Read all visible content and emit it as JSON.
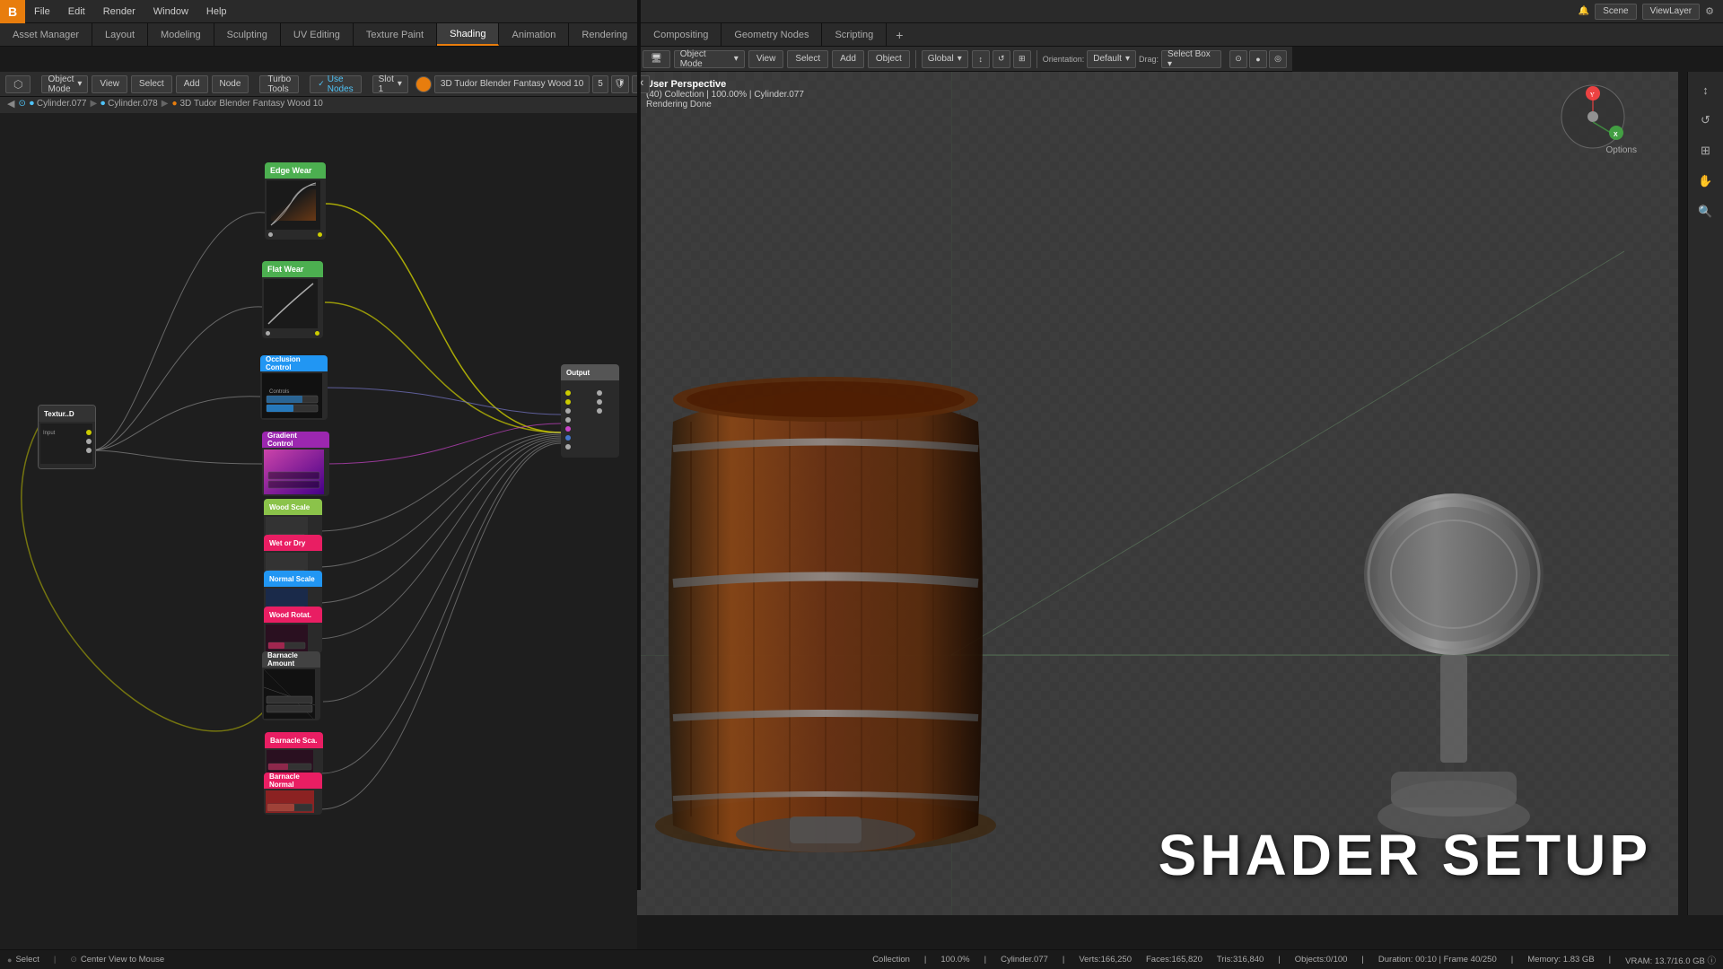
{
  "topMenu": {
    "logo": "B",
    "items": [
      "File",
      "Edit",
      "Render",
      "Window",
      "Help"
    ]
  },
  "workspaceTabs": {
    "items": [
      {
        "label": "Asset Manager",
        "active": false
      },
      {
        "label": "Layout",
        "active": false
      },
      {
        "label": "Modeling",
        "active": false
      },
      {
        "label": "Sculpting",
        "active": false
      },
      {
        "label": "UV Editing",
        "active": false
      },
      {
        "label": "Texture Paint",
        "active": false
      },
      {
        "label": "Shading",
        "active": true
      },
      {
        "label": "Animation",
        "active": false
      },
      {
        "label": "Rendering",
        "active": false
      },
      {
        "label": "Compositing",
        "active": false
      },
      {
        "label": "Geometry Nodes",
        "active": false
      },
      {
        "label": "Scripting",
        "active": false
      }
    ],
    "addIcon": "+"
  },
  "nodeEditorToolbar": {
    "editorType": "⬡",
    "objectMode": "Object Mode",
    "viewLabel": "View",
    "selectLabel": "Select",
    "addLabel": "Add",
    "nodeLabel": "Node",
    "turboTools": "Turbo Tools",
    "useNodes": "Use Nodes",
    "slot": "Slot 1",
    "materialName": "3D Tudor Blender Fantasy Wood 10",
    "matNumber": "5"
  },
  "breadcrumb": {
    "item1": "Cylinder.077",
    "item2": "Cylinder.078",
    "item3": "3D Tudor Blender Fantasy Wood 10"
  },
  "nodes": {
    "edgeWear": {
      "title": "Edge Wear",
      "color": "#4caf50"
    },
    "flatWear": {
      "title": "Flat Wear",
      "color": "#4caf50"
    },
    "occlusionControl": {
      "title": "Occlusion Control",
      "color": "#2196f3"
    },
    "gradientControl": {
      "title": "Gradient Control",
      "color": "#9c27b0"
    },
    "woodScale": {
      "title": "Wood Scale",
      "color": "#8bc34a"
    },
    "wetOrDry": {
      "title": "Wet or Dry",
      "color": "#e91e63"
    },
    "normalScale": {
      "title": "Normal Scale",
      "color": "#2196f3"
    },
    "woodRotation": {
      "title": "Wood Rotat.",
      "color": "#e91e63"
    },
    "barnacleAmount": {
      "title": "Barnacle Amount",
      "color": "#424242"
    },
    "barnacleScale": {
      "title": "Barnacle Sca.",
      "color": "#e91e63"
    },
    "barnacleNormal": {
      "title": "Barnacle Normal",
      "color": "#e91e63"
    },
    "outputNode": {
      "title": "Output",
      "color": "#555"
    },
    "inputNode": {
      "title": "Textur..D",
      "color": "#333"
    }
  },
  "viewport3d": {
    "header": "User Perspective",
    "collection": "(40) Collection",
    "zoom": "100.00%",
    "objectName": "Cylinder.077",
    "status": "Rendering Done",
    "orientation": "Orientation:",
    "orientationVal": "Default",
    "drag": "Drag:",
    "selectBox": "Select Box ▾",
    "viewLabel": "View",
    "selectLabel": "Select",
    "addLabel": "Add",
    "objectLabel": "Object",
    "global": "Global",
    "objectMode": "Object Mode"
  },
  "shaderSetupText": "SHADER  SETUP",
  "statusBar": {
    "select": "Select",
    "centerView": "Center View to Mouse",
    "collection": "Collection",
    "zoom": "100.0%",
    "objectName": "Cylinder.077",
    "verts": "Verts:166,250",
    "faces": "Faces:165,820",
    "tris": "Tris:316,840",
    "objects": "Objects:0/100",
    "duration": "Duration: 00:10 | Frame 40/250",
    "memory": "Memory: 1.83 GB",
    "vram": "VRAM: 13.7/16.0 GB ⓘ"
  },
  "sceneLayer": {
    "scene": "Scene",
    "viewLayer": "ViewLayer"
  }
}
